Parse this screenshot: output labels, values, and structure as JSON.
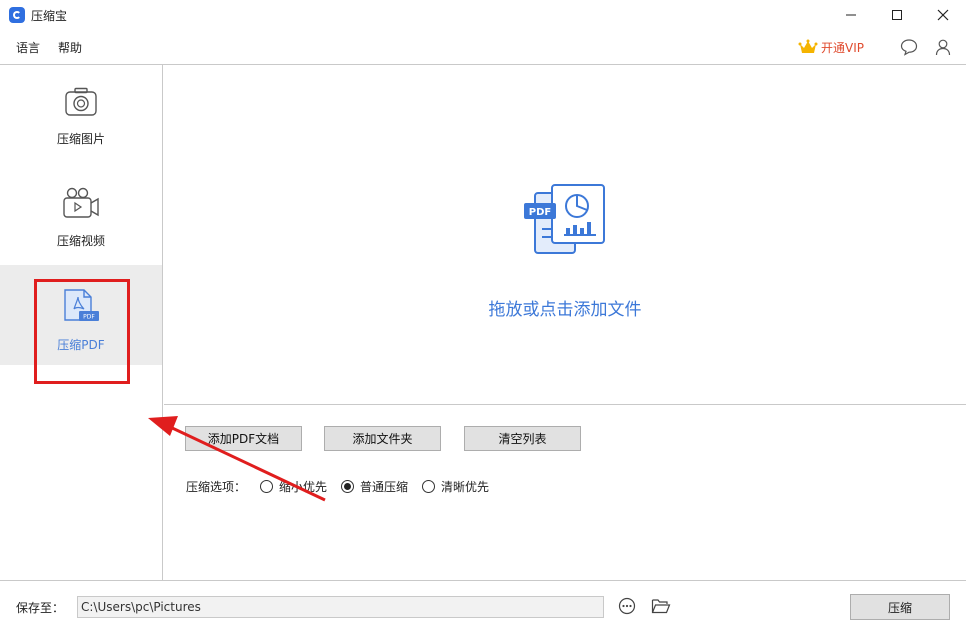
{
  "window": {
    "title": "压缩宝"
  },
  "menu": {
    "items": [
      "语言",
      "帮助"
    ],
    "vip_label": "开通VIP"
  },
  "sidebar": {
    "items": [
      {
        "label": "压缩图片",
        "icon": "camera-icon",
        "active": false
      },
      {
        "label": "压缩视频",
        "icon": "video-camera-icon",
        "active": false
      },
      {
        "label": "压缩PDF",
        "icon": "pdf-file-icon",
        "active": true
      }
    ]
  },
  "dropzone": {
    "text": "拖放或点击添加文件",
    "icon_label": "PDF"
  },
  "toolbar": {
    "add_pdf": "添加PDF文档",
    "add_folder": "添加文件夹",
    "clear_list": "清空列表"
  },
  "options": {
    "label": "压缩选项：",
    "choices": [
      "缩小优先",
      "普通压缩",
      "清晰优先"
    ],
    "selected": "普通压缩"
  },
  "footer": {
    "save_label": "保存至：",
    "path": "C:\\Users\\pc\\Pictures",
    "compress_label": "压缩"
  },
  "colors": {
    "accent": "#3c78d8",
    "highlight": "#e01e1e",
    "vip": "#e04b2e"
  }
}
